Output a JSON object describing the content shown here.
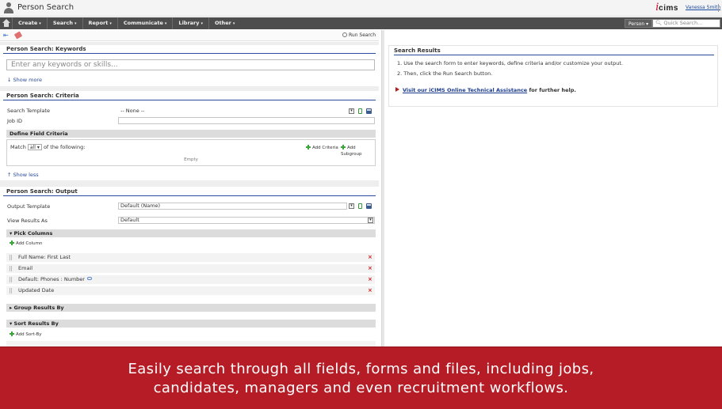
{
  "titlebar": {
    "title": "Person Search",
    "logo_i": "i",
    "logo_rest": "cims",
    "user_name": "Vanessa Smith"
  },
  "navbar": {
    "items": [
      {
        "label": "Create"
      },
      {
        "label": "Search"
      },
      {
        "label": "Report"
      },
      {
        "label": "Communicate"
      },
      {
        "label": "Library"
      },
      {
        "label": "Other"
      }
    ],
    "caret": "▾",
    "scope_label": "Person ▾",
    "quick_search_placeholder": "Quick Search..."
  },
  "toolbar": {
    "run_search_label": "Run Search"
  },
  "keywords": {
    "header": "Person Search: Keywords",
    "placeholder": "Enter any keywords or skills...",
    "show_more": "↓ Show more"
  },
  "criteria": {
    "header": "Person Search: Criteria",
    "search_template_label": "Search Template",
    "search_template_value": "-- None --",
    "job_id_label": "Job ID",
    "job_id_value": "",
    "define_field_criteria": "Define Field Criteria",
    "match_prefix": "Match",
    "match_value": "all",
    "match_suffix": "of the following:",
    "add_criteria": "Add Criteria",
    "add_subgroup": "Add Subgroup",
    "empty_text": "Empty",
    "show_less": "↑ Show less"
  },
  "output": {
    "header": "Person Search: Output",
    "output_template_label": "Output Template",
    "output_template_value": "Default (Name)",
    "view_results_label": "View Results As",
    "view_results_value": "Default",
    "pick_columns": "▾ Pick Columns",
    "add_column": "Add Column",
    "columns": [
      {
        "label": "Full Name: First Last"
      },
      {
        "label": "Email"
      },
      {
        "label": "Default: Phones : Number"
      },
      {
        "label": "Updated Date"
      }
    ],
    "delete_glyph": "×",
    "group_results_by": "▸ Group Results By",
    "sort_results_by": "▾ Sort Results By",
    "add_sort_by": "Add Sort-By"
  },
  "results": {
    "header": "Search Results",
    "instructions": [
      "1.  Use the search form to enter keywords, define criteria and/or customize your output.",
      "2.  Then, click the Run Search button."
    ],
    "help_link": "Visit our iCIMS Online Technical Assistance",
    "help_suffix": " for further help."
  },
  "banner": {
    "line1": "Easily search through all fields, forms and files, including jobs,",
    "line2": "candidates, managers and even recruitment workflows."
  },
  "colors": {
    "navbar": "#4d4d4d",
    "banner": "#b61c25",
    "accent_blue": "#2b4a9c",
    "logo_red": "#c8102e"
  }
}
